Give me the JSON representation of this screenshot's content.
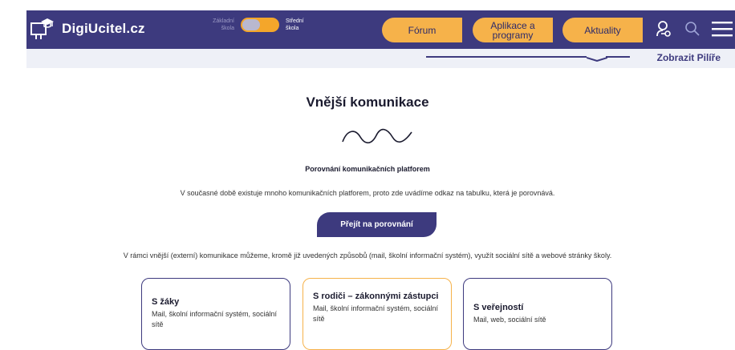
{
  "header": {
    "logo_text": "DigiUcitel.cz",
    "switch": {
      "left_label": "Základní škola",
      "right_label": "Střední škola"
    },
    "nav": [
      {
        "label": "Fórum"
      },
      {
        "label": "Aplikace a programy"
      },
      {
        "label": "Aktuality"
      }
    ],
    "icons": [
      "user-icon",
      "search-icon",
      "menu-icon"
    ]
  },
  "subbar": {
    "link_label": "Zobrazit Pilíře"
  },
  "main": {
    "title": "Vnější komunikace",
    "subtitle": "Porovnání komunikačních platforem",
    "intro": "V současné době existuje mnoho komunikačních platforem, proto zde uvádíme odkaz na tabulku, která je porovnává.",
    "cta_label": "Přejít na porovnání",
    "text2": "V rámci vnější (externí) komunikace můžeme, kromě již uvedených způsobů (mail, školní informační systém), využít sociální sítě a webové stránky školy.",
    "cards": [
      {
        "title": "S žáky",
        "desc": "Mail, školní informační systém, sociální sítě"
      },
      {
        "title": "S rodiči – zákonnými zástupci",
        "desc": "Mail, školní informační systém, sociální sítě"
      },
      {
        "title": "S veřejností",
        "desc": "Mail, web, sociální sítě"
      }
    ]
  },
  "colors": {
    "brand_navy": "#3d3a7e",
    "accent_orange": "#f6b24a"
  }
}
